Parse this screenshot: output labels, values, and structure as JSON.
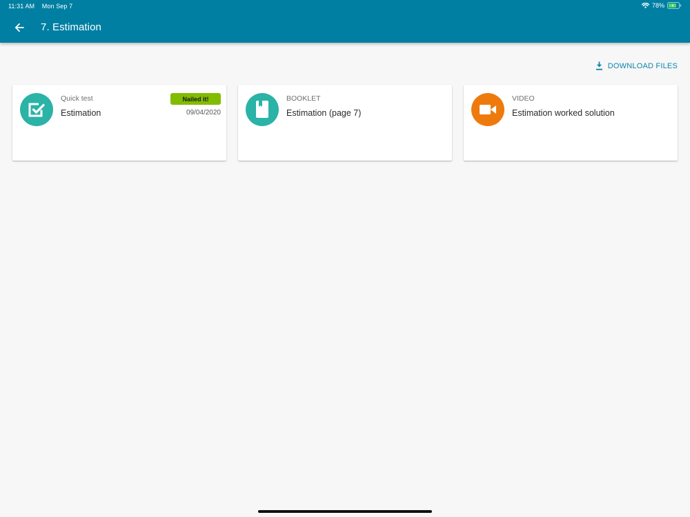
{
  "status_bar": {
    "time": "11:31 AM",
    "date": "Mon Sep 7",
    "battery": "78%"
  },
  "header": {
    "title": "7. Estimation"
  },
  "actions": {
    "download_label": "DOWNLOAD FILES"
  },
  "cards": [
    {
      "type": "Quick test",
      "title": "Estimation",
      "badge": "Nailed it!",
      "date": "09/04/2020",
      "icon": "checkbox-icon",
      "color": "#2ab3a6"
    },
    {
      "type": "BOOKLET",
      "title": "Estimation (page 7)",
      "icon": "booklet-icon",
      "color": "#2ab3a6"
    },
    {
      "type": "VIDEO",
      "title": "Estimation worked solution",
      "icon": "video-camera-icon",
      "color": "#ee7a0d"
    }
  ],
  "colors": {
    "header": "#007fa3",
    "teal": "#2ab3a6",
    "orange": "#ee7a0d",
    "badge": "#82bc00",
    "link": "#0a86aa"
  }
}
